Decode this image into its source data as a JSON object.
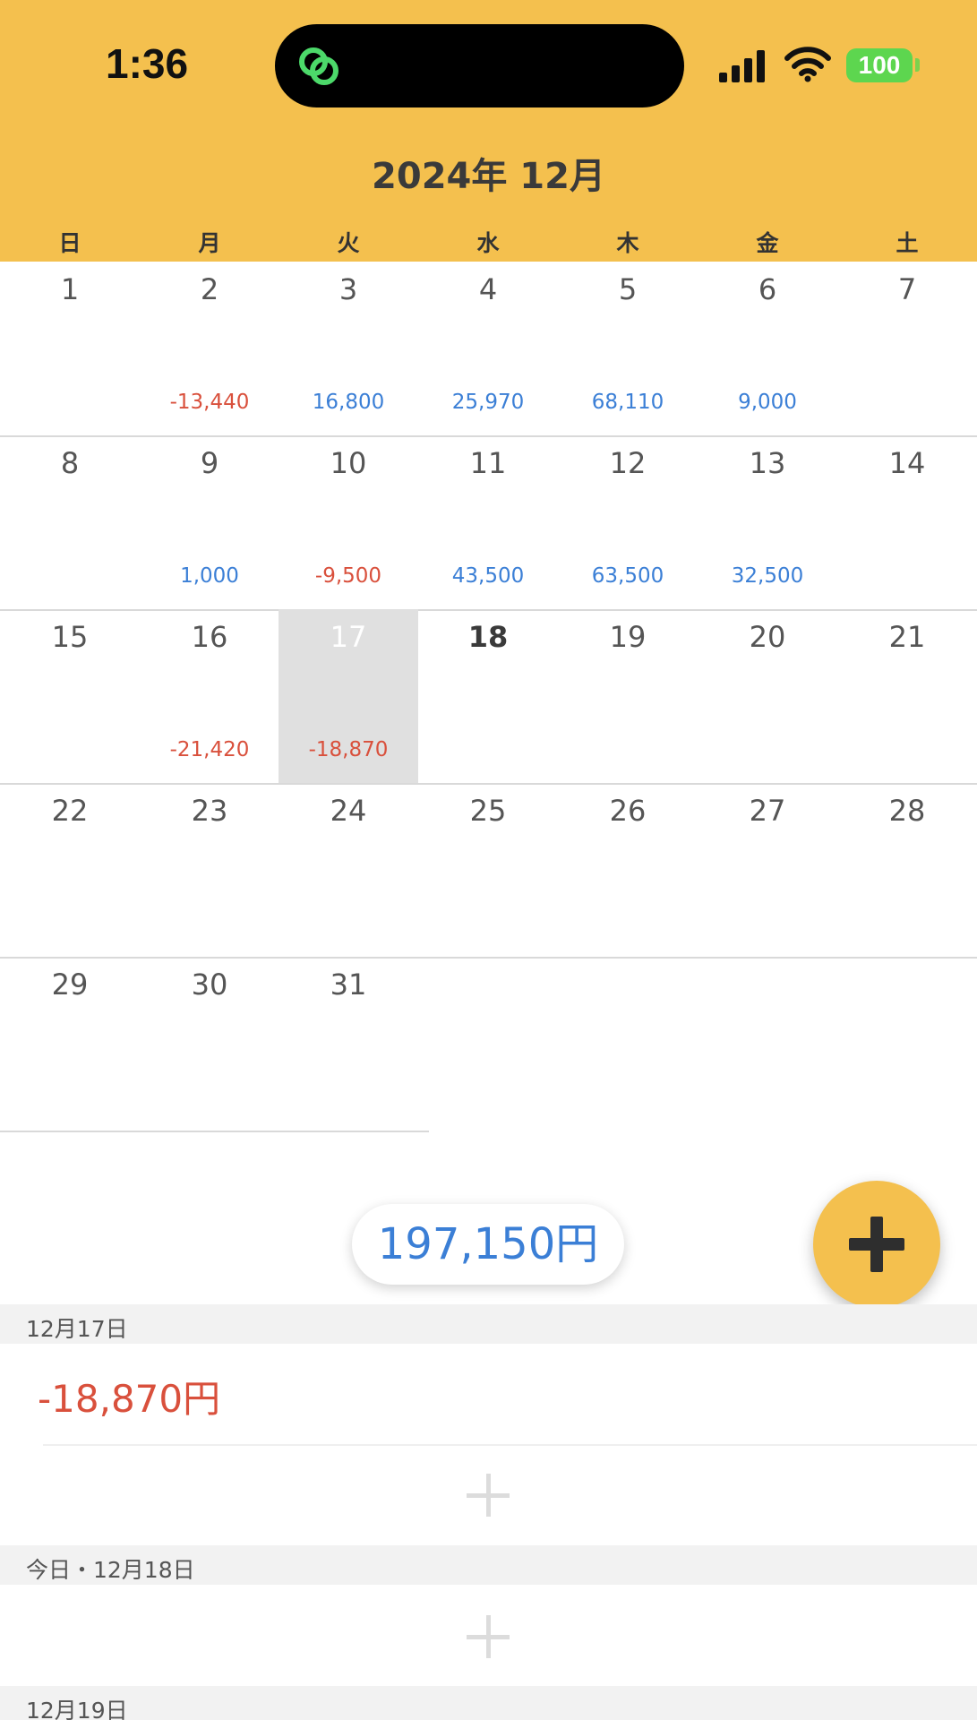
{
  "status_bar": {
    "time": "1:36",
    "battery": "100",
    "island_icon": "link-rings-icon",
    "signal_icon": "cellular-signal-icon",
    "wifi_icon": "wifi-icon"
  },
  "header": {
    "title": "2024年 12月",
    "weekdays": [
      "日",
      "月",
      "火",
      "水",
      "木",
      "金",
      "土"
    ]
  },
  "calendar": {
    "selected_day": "17",
    "today": "18",
    "weeks": [
      [
        {
          "day": "1",
          "amount": ""
        },
        {
          "day": "2",
          "amount": "-13,440",
          "sign": "neg"
        },
        {
          "day": "3",
          "amount": "16,800",
          "sign": "pos"
        },
        {
          "day": "4",
          "amount": "25,970",
          "sign": "pos"
        },
        {
          "day": "5",
          "amount": "68,110",
          "sign": "pos"
        },
        {
          "day": "6",
          "amount": "9,000",
          "sign": "pos"
        },
        {
          "day": "7",
          "amount": ""
        }
      ],
      [
        {
          "day": "8",
          "amount": ""
        },
        {
          "day": "9",
          "amount": "1,000",
          "sign": "pos"
        },
        {
          "day": "10",
          "amount": "-9,500",
          "sign": "neg"
        },
        {
          "day": "11",
          "amount": "43,500",
          "sign": "pos"
        },
        {
          "day": "12",
          "amount": "63,500",
          "sign": "pos"
        },
        {
          "day": "13",
          "amount": "32,500",
          "sign": "pos"
        },
        {
          "day": "14",
          "amount": ""
        }
      ],
      [
        {
          "day": "15",
          "amount": ""
        },
        {
          "day": "16",
          "amount": "-21,420",
          "sign": "neg"
        },
        {
          "day": "17",
          "amount": "-18,870",
          "sign": "neg"
        },
        {
          "day": "18",
          "amount": ""
        },
        {
          "day": "19",
          "amount": ""
        },
        {
          "day": "20",
          "amount": ""
        },
        {
          "day": "21",
          "amount": ""
        }
      ],
      [
        {
          "day": "22",
          "amount": ""
        },
        {
          "day": "23",
          "amount": ""
        },
        {
          "day": "24",
          "amount": ""
        },
        {
          "day": "25",
          "amount": ""
        },
        {
          "day": "26",
          "amount": ""
        },
        {
          "day": "27",
          "amount": ""
        },
        {
          "day": "28",
          "amount": ""
        }
      ],
      [
        {
          "day": "29",
          "amount": ""
        },
        {
          "day": "30",
          "amount": ""
        },
        {
          "day": "31",
          "amount": ""
        }
      ]
    ]
  },
  "total": "197,150円",
  "fab_icon": "plus-icon",
  "list": {
    "sections": [
      {
        "header": "12月17日",
        "entries": [
          "-18,870円"
        ]
      },
      {
        "header": "今日・12月18日",
        "entries": []
      },
      {
        "header": "12月19日",
        "entries": []
      }
    ]
  },
  "colors": {
    "header_bg": "#F4C04E",
    "positive": "#3B7FD6",
    "negative": "#D9503C",
    "selected_bg": "#E0E0E0"
  }
}
